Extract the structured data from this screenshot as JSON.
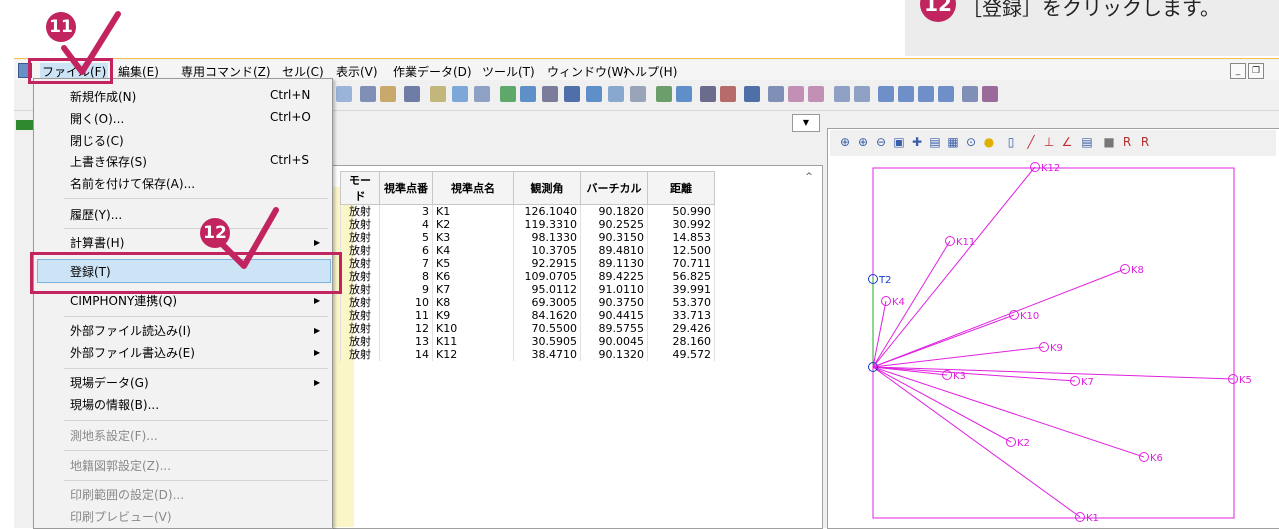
{
  "callout": {
    "number": "12",
    "text": "［登録］をクリックします。"
  },
  "annotations": {
    "badge_file": "11",
    "badge_register": "12"
  },
  "menubar": {
    "items": [
      "ファイル(F)",
      "編集(E)",
      "専用コマンド(Z)",
      "セル(C)",
      "表示(V)",
      "作業データ(D)",
      "ツール(T)",
      "ウィンドウ(W)",
      "ヘルプ(H)"
    ]
  },
  "file_menu": {
    "new": "新規作成(N)",
    "new_sc": "Ctrl+N",
    "open": "開く(O)...",
    "open_sc": "Ctrl+O",
    "close": "閉じる(C)",
    "save": "上書き保存(S)",
    "save_sc": "Ctrl+S",
    "save_as": "名前を付けて保存(A)...",
    "history": "履歴(Y)...",
    "calc": "計算書(H)",
    "register": "登録(T)",
    "cimphony": "CIMPHONY連携(Q)",
    "import": "外部ファイル読込み(I)",
    "export": "外部ファイル書込み(E)",
    "site_data": "現場データ(G)",
    "site_info": "現場の情報(B)...",
    "survey_settings": "測地系設定(F)...",
    "cadastral_settings": "地籍図郭設定(Z)...",
    "print_range": "印刷範囲の設定(D)...",
    "print_preview": "印刷プレビュー(V)"
  },
  "table": {
    "columns": [
      "モード",
      "視準点番",
      "視準点名",
      "観測角",
      "バーチカル",
      "距離"
    ],
    "rows": [
      [
        "放射",
        "3",
        "K1",
        "126.1040",
        "90.1820",
        "50.990"
      ],
      [
        "放射",
        "4",
        "K2",
        "119.3310",
        "90.2525",
        "30.992"
      ],
      [
        "放射",
        "5",
        "K3",
        "98.1330",
        "90.3150",
        "14.853"
      ],
      [
        "放射",
        "6",
        "K4",
        "10.3705",
        "89.4810",
        "12.500"
      ],
      [
        "放射",
        "7",
        "K5",
        "92.2915",
        "89.1130",
        "70.711"
      ],
      [
        "放射",
        "8",
        "K6",
        "109.0705",
        "89.4225",
        "56.825"
      ],
      [
        "放射",
        "9",
        "K7",
        "95.0112",
        "91.0110",
        "39.991"
      ],
      [
        "放射",
        "10",
        "K8",
        "69.3005",
        "90.3750",
        "53.370"
      ],
      [
        "放射",
        "11",
        "K9",
        "84.1620",
        "90.4415",
        "33.713"
      ],
      [
        "放射",
        "12",
        "K10",
        "70.5500",
        "89.5755",
        "29.426"
      ],
      [
        "放射",
        "13",
        "K11",
        "30.5905",
        "90.0045",
        "28.160"
      ],
      [
        "放射",
        "14",
        "K12",
        "38.4710",
        "90.1320",
        "49.572"
      ]
    ]
  },
  "diagram": {
    "points": [
      "K12",
      "K11",
      "K8",
      "T2",
      "K4",
      "K10",
      "K9",
      "K3",
      "K7",
      "K5",
      "K2",
      "K6",
      "K1"
    ],
    "line_color": "#e020e0",
    "station_color": "#1a3cc8"
  }
}
